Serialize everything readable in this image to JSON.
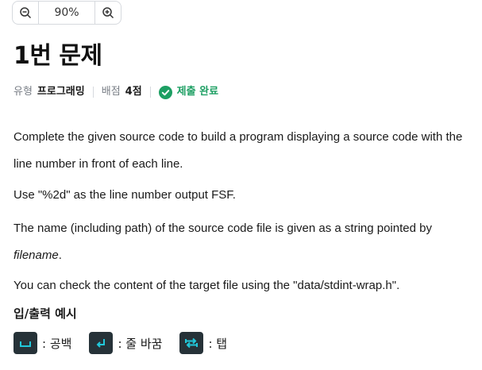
{
  "zoom": {
    "level": "90%"
  },
  "title": "1번 문제",
  "meta": {
    "type_label": "유형",
    "type_value": "프로그래밍",
    "score_label": "배점",
    "score_value": "4점",
    "status": "제출 완료"
  },
  "description": {
    "p1": "Complete the given source code to build a program displaying a source code with the line number in front of each line.",
    "p2": "Use \"%2d\" as the line number output FSF.",
    "p3_before": "The name (including path) of the source code file is given as a string pointed by ",
    "p3_em": "filename",
    "p3_after": ".",
    "p4": "You can check the content of the target file using the \"data/stdint-wrap.h\"."
  },
  "examples": {
    "heading": "입/출력 예시",
    "legend": [
      {
        "icon": "space-icon",
        "label": ": 공백"
      },
      {
        "icon": "newline-icon",
        "label": ": 줄 바꿈"
      },
      {
        "icon": "tab-icon",
        "label": ": 탭"
      }
    ]
  },
  "colors": {
    "status_green": "#1d9f63",
    "key_bg": "#263238",
    "key_accent": "#21c7d9"
  }
}
